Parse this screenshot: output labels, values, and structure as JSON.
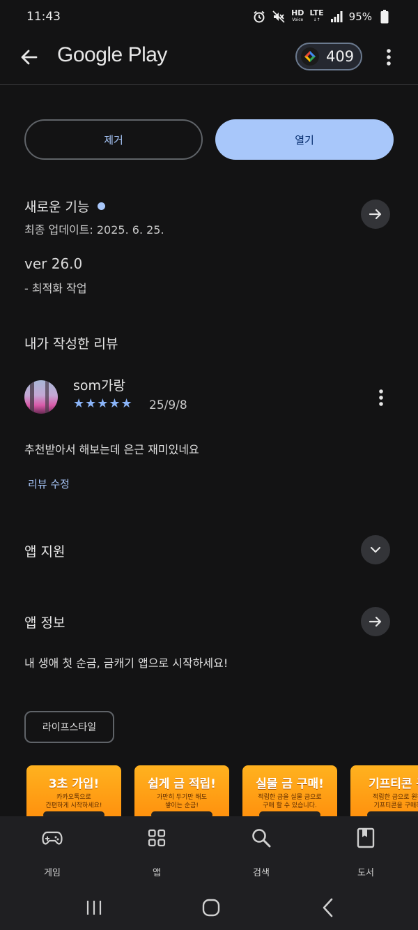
{
  "status_bar": {
    "time": "11:43",
    "network": "HD",
    "network_sub": "Voice",
    "lte": "LTE",
    "battery": "95%"
  },
  "app_bar": {
    "title": "Google Play",
    "points": "409",
    "back_icon": "arrow-back-icon",
    "menu_icon": "more-vert-icon"
  },
  "actions": {
    "remove_label": "제거",
    "open_label": "열기"
  },
  "whats_new": {
    "title": "새로운 기능",
    "updated_label": "최종 업데이트: 2025. 6. 25.",
    "version": "ver 26.0",
    "note": "- 최적화 작업"
  },
  "my_review": {
    "section_title": "내가 작성한 리뷰",
    "reviewer": "som가랑",
    "stars": "★★★★★",
    "rating": 5,
    "date": "25/9/8",
    "text": "추천받아서 해보는데 은근 재미있네요",
    "edit_label": "리뷰 수정"
  },
  "app_support": {
    "title": "앱 지원"
  },
  "app_info": {
    "title": "앱 정보",
    "description": "내 생애 첫 순금, 금캐기 앱으로 시작하세요!",
    "category": "라이프스타일"
  },
  "screenshots": [
    {
      "headline": "3초 가입!",
      "sub1": "카카오톡으로",
      "sub2": "간편하게 시작하세요!"
    },
    {
      "headline": "쉽게 금 적립!",
      "sub1": "가만히 두기만 해도",
      "sub2": "쌓이는 순금!"
    },
    {
      "headline": "실물 금 구매!",
      "sub1": "적립한 금을 실물 금으로",
      "sub2": "구매 할 수 있습니다."
    },
    {
      "headline": "기프티콘 구",
      "sub1": "적립한 금으로 원하",
      "sub2": "기프티콘을 구매하"
    }
  ],
  "bottom_nav": [
    {
      "label": "게임",
      "icon": "gamepad-icon"
    },
    {
      "label": "앱",
      "icon": "apps-grid-icon"
    },
    {
      "label": "검색",
      "icon": "search-icon"
    },
    {
      "label": "도서",
      "icon": "book-icon"
    }
  ],
  "colors": {
    "background": "#131314",
    "accent": "#a8c7fa",
    "star": "#8ab4f8",
    "open_button_text": "#062e6f"
  }
}
